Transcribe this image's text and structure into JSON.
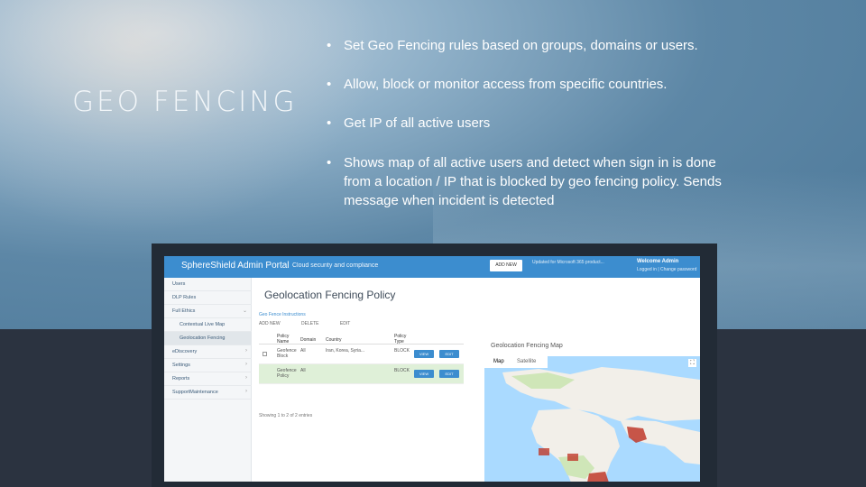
{
  "slide": {
    "title": "GEO FENCING",
    "bullets": [
      "Set Geo Fencing rules based on groups, domains or users.",
      "Allow, block or monitor access from specific countries.",
      "Get IP of all active users",
      "Shows map of all active users and detect when sign in is done from a location / IP that is blocked by geo fencing policy. Sends message when incident is detected"
    ],
    "bullet_glyph": "•"
  },
  "app": {
    "brand": "SphereShield Admin Portal",
    "tagline": "Cloud security and compliance",
    "top_button": "ADD NEW",
    "top_info": "Updated for Microsoft 365 product...",
    "welcome": "Welcome Admin",
    "user_line": "Logged in | Change password",
    "sidebar": [
      {
        "label": "Users",
        "icon": "users-icon"
      },
      {
        "label": "DLP Rules",
        "icon": "rules-icon"
      },
      {
        "label": "Full Ethics",
        "icon": "ethics-icon"
      },
      {
        "label": "Contextual Live Map",
        "icon": "map-icon"
      },
      {
        "label": "Geolocation Fencing",
        "icon": "fence-icon"
      },
      {
        "label": "eDiscovery",
        "icon": "discovery-icon"
      },
      {
        "label": "Settings",
        "icon": "gear-icon"
      },
      {
        "label": "Reports",
        "icon": "report-icon"
      },
      {
        "label": "SupportMaintenance",
        "icon": "support-icon"
      }
    ],
    "page_title": "Geolocation Fencing Policy",
    "pane_toggle": "Geo Fence Instructions",
    "filters": [
      "ADD NEW",
      "DELETE",
      "EDIT"
    ],
    "table": {
      "headers": [
        "Policy Name",
        "Domain",
        "Country",
        "Policy Type"
      ],
      "rows": [
        {
          "name": "Geofence Block",
          "domain": "All",
          "country": "Iran, Korea, Syria...",
          "type": "BLOCK",
          "view": "VIEW",
          "edit": "EDIT"
        },
        {
          "name": "Geofence Policy",
          "domain": "All",
          "country": "",
          "type": "BLOCK",
          "view": "VIEW",
          "edit": "EDIT"
        }
      ]
    },
    "showing": "Showing 1 to 2 of 2 entries",
    "map": {
      "title": "Geolocation Fencing Map",
      "tabs": [
        "Map",
        "Satellite"
      ],
      "colors": {
        "water": "#aadaff",
        "land": "#f2efe9",
        "green": "#cfe6b8",
        "blocked": "#c0392b"
      }
    }
  }
}
